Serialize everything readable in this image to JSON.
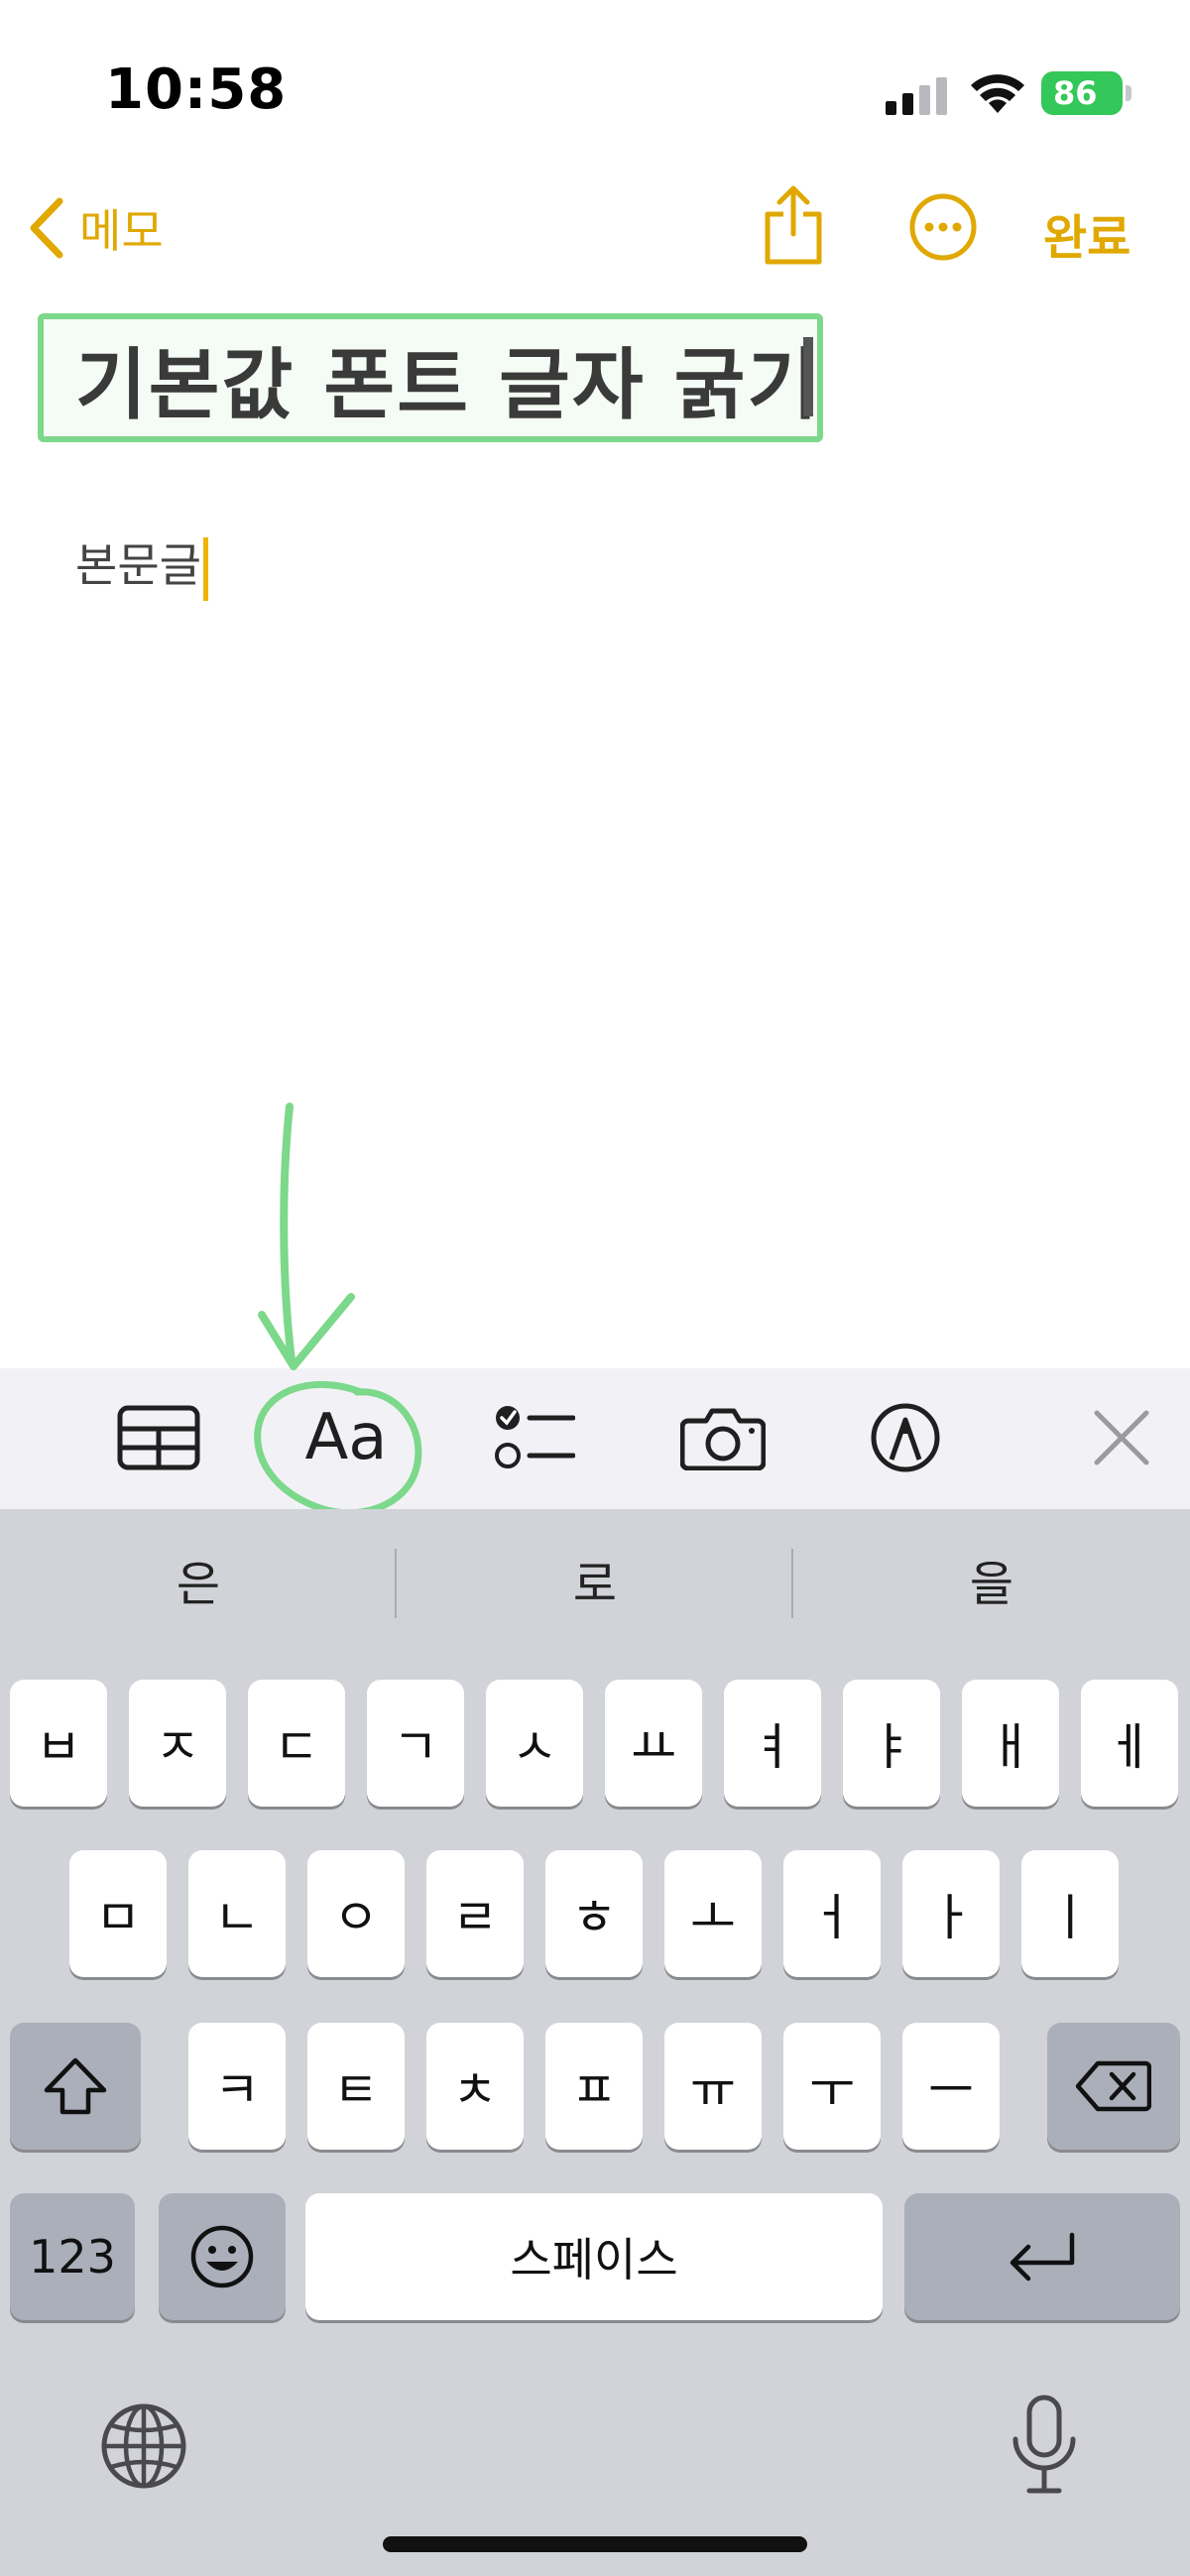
{
  "status_bar": {
    "time": "10:58",
    "battery": "86"
  },
  "nav": {
    "back_label": "메모",
    "done_label": "완료"
  },
  "note": {
    "title": "기본값 폰트 글자 굵기",
    "body": "본문글"
  },
  "toolbar": {
    "format_label": "Aa",
    "icons": [
      "table-icon",
      "format-icon",
      "checklist-icon",
      "camera-icon",
      "markup-icon",
      "close-icon"
    ]
  },
  "keyboard": {
    "suggestions": [
      "은",
      "로",
      "을"
    ],
    "row1": [
      "ㅂ",
      "ㅈ",
      "ㄷ",
      "ㄱ",
      "ㅅ",
      "ㅛ",
      "ㅕ",
      "ㅑ",
      "ㅐ",
      "ㅔ"
    ],
    "row2": [
      "ㅁ",
      "ㄴ",
      "ㅇ",
      "ㄹ",
      "ㅎ",
      "ㅗ",
      "ㅓ",
      "ㅏ",
      "ㅣ"
    ],
    "row3": [
      "ㅋ",
      "ㅌ",
      "ㅊ",
      "ㅍ",
      "ㅠ",
      "ㅜ",
      "ㅡ"
    ],
    "numbers_label": "123",
    "space_label": "스페이스"
  },
  "colors": {
    "accent": "#e0a800",
    "annotation": "#7cd88a",
    "keyboard_bg": "#d1d3d9"
  }
}
